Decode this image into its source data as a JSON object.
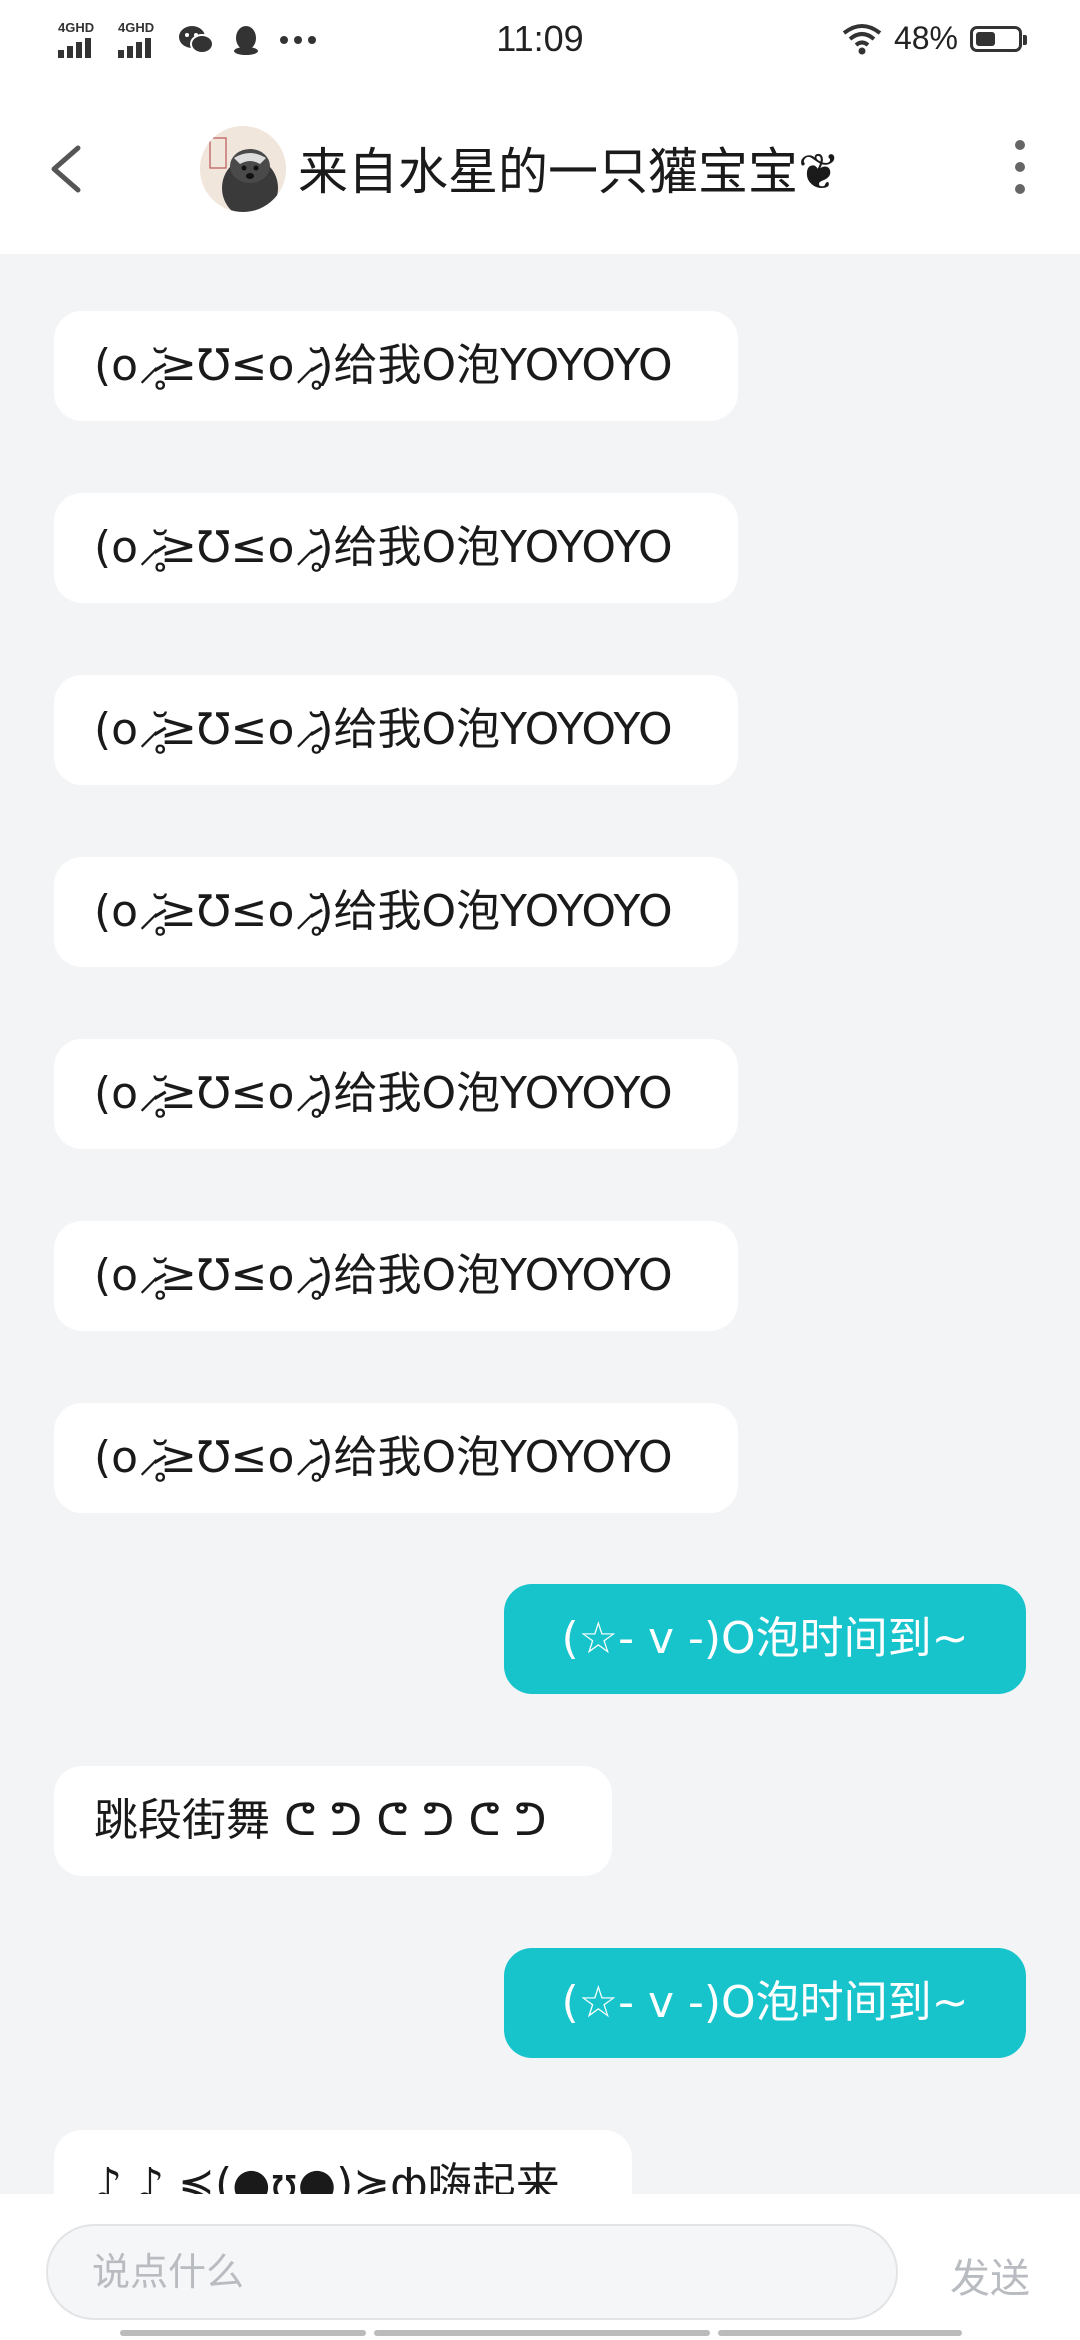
{
  "status_bar": {
    "signal_1_label": "4GHD",
    "signal_2_label": "4GHD",
    "time": "11:09",
    "battery_percent": "48%",
    "battery_level": 0.48,
    "icons": [
      "signal-icon",
      "signal-icon",
      "wechat-icon",
      "qq-icon",
      "more-dots-icon",
      "wifi-icon",
      "battery-icon"
    ]
  },
  "header": {
    "title": "来自水星的一只獾宝宝❦",
    "back_icon": "chevron-left-icon",
    "more_icon": "more-vertical-icon"
  },
  "messages": [
    {
      "side": "in",
      "text": "(o⸝̷̥̆≥Ʊ≤o⸝̷̥̆)给我O泡YOYOYO"
    },
    {
      "side": "in",
      "text": "(o⸝̷̥̆≥Ʊ≤o⸝̷̥̆)给我O泡YOYOYO"
    },
    {
      "side": "in",
      "text": "(o⸝̷̥̆≥Ʊ≤o⸝̷̥̆)给我O泡YOYOYO"
    },
    {
      "side": "in",
      "text": "(o⸝̷̥̆≥Ʊ≤o⸝̷̥̆)给我O泡YOYOYO"
    },
    {
      "side": "in",
      "text": "(o⸝̷̥̆≥Ʊ≤o⸝̷̥̆)给我O泡YOYOYO"
    },
    {
      "side": "in",
      "text": "(o⸝̷̥̆≥Ʊ≤o⸝̷̥̆)给我O泡YOYOYO"
    },
    {
      "side": "in",
      "text": "(o⸝̷̥̆≥Ʊ≤o⸝̷̥̆)给我O泡YOYOYO"
    },
    {
      "side": "out",
      "text": "(☆- v -)O泡时间到~"
    },
    {
      "side": "in",
      "text": "跳段街舞 ᕦ ᕤ ᕦ ᕤ ᕦ ᕤ"
    },
    {
      "side": "out",
      "text": "(☆- v -)O泡时间到~"
    },
    {
      "side": "in",
      "text": "♪ ♪ ≼(●ʊ̬●)≽ф嗨起来"
    }
  ],
  "input": {
    "placeholder": "说点什么",
    "send_label": "发送"
  },
  "colors": {
    "outgoing_bubble": "#17c4cc",
    "incoming_bubble": "#ffffff",
    "chat_background": "#f3f4f6"
  }
}
